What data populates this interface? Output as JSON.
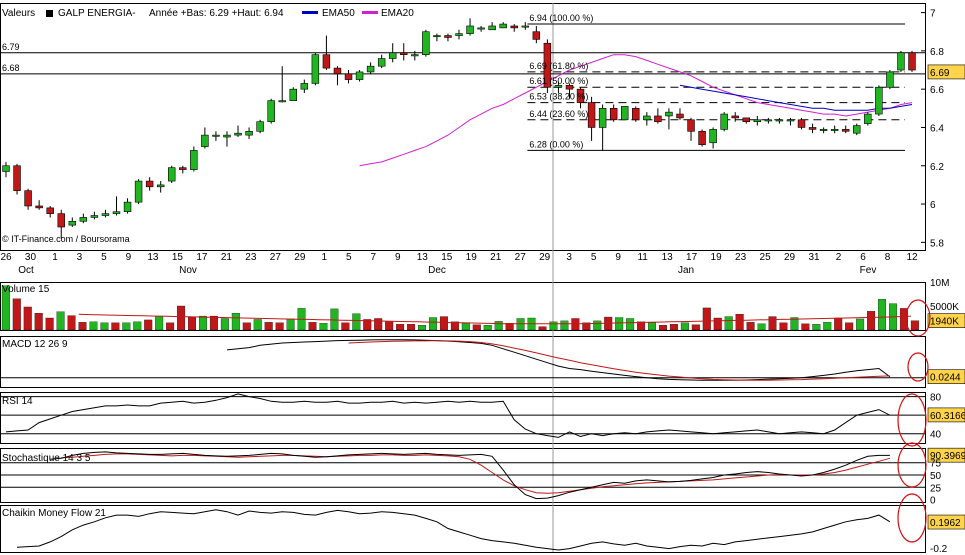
{
  "header": {
    "label": "Valeurs",
    "name": "GALP ENERGIA-",
    "range": "Année +Bas: 6.29 +Haut: 6.94",
    "legend": [
      {
        "name": "EMA50",
        "color": "#0000c0"
      },
      {
        "name": "EMA20",
        "color": "#d020d0"
      }
    ]
  },
  "colors": {
    "up": "#22b522",
    "down": "#c01818",
    "frame": "#000000",
    "grid": "#c8c8c8",
    "badge": "#ffd34a"
  },
  "credit": "© IT-Finance.com / Boursorama",
  "x_axis": {
    "days": [
      "26",
      "30",
      "1",
      "3",
      "5",
      "9",
      "13",
      "15",
      "17",
      "21",
      "23",
      "27",
      "29",
      "1",
      "5",
      "7",
      "9",
      "13",
      "15",
      "19",
      "21",
      "27",
      "29",
      "3",
      "5",
      "9",
      "11",
      "13",
      "17",
      "19",
      "23",
      "25",
      "29",
      "31",
      "2",
      "6",
      "8",
      "12"
    ],
    "months": [
      "Oct",
      "Nov",
      "Dec",
      "Jan",
      "Fev"
    ]
  },
  "chart_data": [
    {
      "type": "candlestick",
      "title": "",
      "y_ticks": [
        "7",
        "6.8",
        "6.6",
        "6.4",
        "6.2",
        "6",
        "5.8"
      ],
      "ylim": [
        5.76,
        7.05
      ],
      "last_value": "6.69",
      "h_lines": [
        {
          "label": "6.79",
          "value": 6.79
        },
        {
          "label": "6.68",
          "value": 6.68
        }
      ],
      "fibonacci": [
        {
          "label": "6.94 (100.00 %)",
          "value": 6.94
        },
        {
          "label": "6.69 (61.80 %)",
          "value": 6.69
        },
        {
          "label": "6.61 (50.00 %)",
          "value": 6.61
        },
        {
          "label": "6.53 (38.20 %)",
          "value": 6.53
        },
        {
          "label": "6.44 (23.60 %)",
          "value": 6.44
        },
        {
          "label": "6.28 (0.00 %)",
          "value": 6.28
        }
      ],
      "candles": [
        [
          6.17,
          6.2,
          6.22,
          6.14
        ],
        [
          6.2,
          6.07,
          6.21,
          6.05
        ],
        [
          6.07,
          5.99,
          6.08,
          5.97
        ],
        [
          5.99,
          5.98,
          6.02,
          5.97
        ],
        [
          5.98,
          5.95,
          5.99,
          5.93
        ],
        [
          5.95,
          5.88,
          5.97,
          5.82
        ],
        [
          5.89,
          5.91,
          5.93,
          5.88
        ],
        [
          5.91,
          5.93,
          5.95,
          5.9
        ],
        [
          5.93,
          5.94,
          5.96,
          5.92
        ],
        [
          5.94,
          5.95,
          5.97,
          5.93
        ],
        [
          5.95,
          5.96,
          6.04,
          5.94
        ],
        [
          5.96,
          6.01,
          6.03,
          5.95
        ],
        [
          6.01,
          6.12,
          6.13,
          6.0
        ],
        [
          6.12,
          6.09,
          6.14,
          6.07
        ],
        [
          6.09,
          6.1,
          6.12,
          6.06
        ],
        [
          6.12,
          6.19,
          6.2,
          6.11
        ],
        [
          6.19,
          6.18,
          6.2,
          6.16
        ],
        [
          6.18,
          6.28,
          6.3,
          6.17
        ],
        [
          6.3,
          6.36,
          6.4,
          6.29
        ],
        [
          6.36,
          6.36,
          6.38,
          6.33
        ],
        [
          6.35,
          6.36,
          6.38,
          6.3
        ],
        [
          6.36,
          6.37,
          6.41,
          6.35
        ],
        [
          6.36,
          6.38,
          6.4,
          6.34
        ],
        [
          6.38,
          6.43,
          6.44,
          6.37
        ],
        [
          6.43,
          6.54,
          6.55,
          6.42
        ],
        [
          6.54,
          6.54,
          6.72,
          6.53
        ],
        [
          6.54,
          6.6,
          6.61,
          6.55
        ],
        [
          6.6,
          6.63,
          6.65,
          6.58
        ],
        [
          6.63,
          6.78,
          6.79,
          6.62
        ],
        [
          6.78,
          6.71,
          6.88,
          6.7
        ],
        [
          6.71,
          6.68,
          6.72,
          6.62
        ],
        [
          6.68,
          6.65,
          6.7,
          6.63
        ],
        [
          6.65,
          6.69,
          6.7,
          6.64
        ],
        [
          6.69,
          6.72,
          6.74,
          6.68
        ],
        [
          6.72,
          6.76,
          6.78,
          6.71
        ],
        [
          6.76,
          6.79,
          6.84,
          6.74
        ],
        [
          6.79,
          6.78,
          6.84,
          6.75
        ],
        [
          6.78,
          6.78,
          6.8,
          6.75
        ],
        [
          6.78,
          6.9,
          6.91,
          6.77
        ],
        [
          6.88,
          6.88,
          6.89,
          6.85
        ],
        [
          6.88,
          6.87,
          6.89,
          6.85
        ],
        [
          6.88,
          6.89,
          6.91,
          6.86
        ],
        [
          6.89,
          6.93,
          6.97,
          6.88
        ],
        [
          6.92,
          6.92,
          6.93,
          6.9
        ],
        [
          6.91,
          6.93,
          6.95,
          6.91
        ],
        [
          6.92,
          6.94,
          6.95,
          6.92
        ],
        [
          6.93,
          6.92,
          6.94,
          6.9
        ],
        [
          6.93,
          6.93,
          6.95,
          6.91
        ],
        [
          6.9,
          6.86,
          6.93,
          6.84
        ],
        [
          6.84,
          6.61,
          6.86,
          6.58
        ],
        [
          6.61,
          6.62,
          6.64,
          6.58
        ],
        [
          6.62,
          6.6,
          6.63,
          6.55
        ],
        [
          6.6,
          6.53,
          6.61,
          6.5
        ],
        [
          6.53,
          6.4,
          6.56,
          6.33
        ],
        [
          6.4,
          6.5,
          6.52,
          6.28
        ],
        [
          6.5,
          6.44,
          6.52,
          6.43
        ],
        [
          6.44,
          6.51,
          6.51,
          6.45
        ],
        [
          6.5,
          6.44,
          6.51,
          6.43
        ],
        [
          6.44,
          6.46,
          6.48,
          6.41
        ],
        [
          6.46,
          6.43,
          6.5,
          6.42
        ],
        [
          6.46,
          6.48,
          6.5,
          6.39
        ],
        [
          6.47,
          6.45,
          6.5,
          6.44
        ],
        [
          6.44,
          6.38,
          6.45,
          6.33
        ],
        [
          6.38,
          6.31,
          6.39,
          6.3
        ],
        [
          6.32,
          6.39,
          6.4,
          6.29
        ],
        [
          6.39,
          6.47,
          6.48,
          6.38
        ],
        [
          6.46,
          6.45,
          6.48,
          6.43
        ],
        [
          6.45,
          6.43,
          6.45,
          6.42
        ],
        [
          6.43,
          6.44,
          6.46,
          6.41
        ],
        [
          6.44,
          6.44,
          6.45,
          6.42
        ],
        [
          6.44,
          6.44,
          6.45,
          6.42
        ],
        [
          6.44,
          6.44,
          6.45,
          6.41
        ],
        [
          6.44,
          6.4,
          6.45,
          6.39
        ],
        [
          6.4,
          6.39,
          6.42,
          6.37
        ],
        [
          6.39,
          6.39,
          6.4,
          6.37
        ],
        [
          6.39,
          6.39,
          6.41,
          6.37
        ],
        [
          6.39,
          6.38,
          6.41,
          6.37
        ],
        [
          6.37,
          6.41,
          6.42,
          6.36
        ],
        [
          6.42,
          6.47,
          6.48,
          6.41
        ],
        [
          6.47,
          6.61,
          6.62,
          6.46
        ],
        [
          6.61,
          6.69,
          6.7,
          6.6
        ],
        [
          6.7,
          6.79,
          6.8,
          6.69
        ],
        [
          6.79,
          6.7,
          6.8,
          6.69
        ]
      ],
      "ema20": [
        6.2,
        6.21,
        6.22,
        6.24,
        6.26,
        6.28,
        6.3,
        6.33,
        6.36,
        6.4,
        6.44,
        6.47,
        6.5,
        6.52,
        6.55,
        6.58,
        6.61,
        6.64,
        6.67,
        6.7,
        6.72,
        6.74,
        6.76,
        6.78,
        6.78,
        6.77,
        6.75,
        6.73,
        6.71,
        6.69,
        6.67,
        6.64,
        6.61,
        6.59,
        6.57,
        6.55,
        6.53,
        6.52,
        6.51,
        6.5,
        6.49,
        6.48,
        6.47,
        6.47,
        6.46,
        6.47,
        6.48,
        6.49,
        6.5,
        6.52,
        6.53
      ],
      "ema50": [
        6.62,
        6.61,
        6.6,
        6.59,
        6.58,
        6.57,
        6.56,
        6.55,
        6.54,
        6.53,
        6.52,
        6.51,
        6.5,
        6.5,
        6.49,
        6.49,
        6.49,
        6.49,
        6.5,
        6.5,
        6.51,
        6.52
      ]
    },
    {
      "type": "bar",
      "title": "Volume 15",
      "y_ticks": [
        "10M",
        "5000K",
        "0"
      ],
      "ylim": [
        0,
        10000
      ],
      "last_value": "1940K",
      "values": [
        9200,
        6500,
        4800,
        3500,
        2500,
        3800,
        3000,
        1600,
        1700,
        1500,
        1500,
        1500,
        1700,
        2100,
        2900,
        1500,
        5000,
        2700,
        2900,
        2900,
        2400,
        3500,
        1500,
        2200,
        1600,
        1500,
        2300,
        4500,
        1600,
        1400,
        4400,
        1500,
        3400,
        2200,
        2400,
        1700,
        1200,
        1200,
        1000,
        2600,
        2800,
        1700,
        1400,
        1100,
        1000,
        1800,
        1400,
        2400,
        2500,
        700,
        1700,
        1900,
        2400,
        1500,
        1900,
        2700,
        2600,
        2400,
        1700,
        1500,
        1000,
        1200,
        1500,
        1100,
        4600,
        2500,
        2800,
        3300,
        1600,
        1300,
        2800,
        1500,
        2600,
        1300,
        1200,
        1600,
        2500,
        1500,
        2300,
        3900,
        6400,
        5500,
        4500,
        1940
      ],
      "ma": [
        3300,
        3200,
        3150,
        3100,
        3050,
        3000,
        2950,
        2900,
        2850,
        2800,
        2750,
        2700,
        2650,
        2600,
        2550,
        2500,
        2450,
        2400,
        2350,
        2300,
        2250,
        2200,
        2150,
        2100,
        2050,
        2000,
        1950,
        1900,
        1850,
        1800,
        1750,
        1700,
        1650,
        1600,
        1550,
        1500,
        1450,
        1400,
        1350,
        1300,
        1300,
        1300,
        1300,
        1300,
        1300,
        1300,
        1300,
        1350,
        1400,
        1450,
        1500,
        1550,
        1600,
        1650,
        1700,
        1750,
        1800,
        1850,
        1900,
        1950,
        2000,
        2050,
        2100,
        2150,
        2200,
        2250,
        2300,
        2350,
        2400,
        2450,
        2500,
        2550,
        2600,
        2650,
        2700,
        2800,
        2900
      ]
    },
    {
      "type": "line",
      "title": "MACD 12 26 9",
      "y_ticks": [],
      "ylim": [
        -0.02,
        0.2
      ],
      "zero_line": 0.02,
      "last_value": "0.0244",
      "macd": [
        0.14,
        0.145,
        0.15,
        0.16,
        0.165,
        0.17,
        0.172,
        0.174,
        0.176,
        0.178,
        0.18,
        0.181,
        0.182,
        0.183,
        0.184,
        0.184,
        0.184,
        0.183,
        0.182,
        0.18,
        0.178,
        0.175,
        0.172,
        0.168,
        0.16,
        0.145,
        0.13,
        0.115,
        0.1,
        0.085,
        0.07,
        0.06,
        0.055,
        0.048,
        0.042,
        0.036,
        0.03,
        0.025,
        0.02,
        0.016,
        0.013,
        0.011,
        0.01,
        0.009,
        0.009,
        0.009,
        0.009,
        0.01,
        0.012,
        0.014,
        0.016,
        0.018,
        0.02,
        0.025,
        0.03,
        0.036,
        0.044,
        0.05,
        0.055,
        0.06,
        0.024
      ],
      "signal": [
        0.17,
        0.172,
        0.174,
        0.176,
        0.177,
        0.178,
        0.179,
        0.179,
        0.18,
        0.179,
        0.178,
        0.176,
        0.172,
        0.166,
        0.158,
        0.148,
        0.138,
        0.127,
        0.116,
        0.105,
        0.095,
        0.085,
        0.076,
        0.067,
        0.059,
        0.051,
        0.044,
        0.038,
        0.032,
        0.027,
        0.023,
        0.019,
        0.016,
        0.013,
        0.011,
        0.01,
        0.009,
        0.009,
        0.009,
        0.01,
        0.011,
        0.012,
        0.014,
        0.016,
        0.018,
        0.02,
        0.022,
        0.024,
        0.026,
        0.028
      ]
    },
    {
      "type": "line",
      "title": "RSI 14",
      "y_ticks": [
        "80",
        "60",
        "40"
      ],
      "ylim": [
        30,
        85
      ],
      "last_value": "60.3166",
      "values": [
        42,
        43,
        44,
        52,
        56,
        60,
        64,
        66,
        68,
        70,
        70,
        71,
        70,
        70,
        73,
        74,
        75,
        73,
        74,
        76,
        79,
        83,
        80,
        78,
        75,
        74,
        74,
        75,
        74,
        74,
        75,
        73,
        73,
        74,
        74,
        75,
        73,
        74,
        73,
        74,
        75,
        74,
        75,
        74,
        74,
        75,
        55,
        45,
        40,
        38,
        36,
        42,
        37,
        40,
        38,
        40,
        41,
        40,
        42,
        43,
        44,
        43,
        42,
        41,
        40,
        41,
        42,
        43,
        44,
        42,
        40,
        41,
        42,
        41,
        40,
        44,
        52,
        60,
        63,
        66,
        60
      ]
    },
    {
      "type": "line",
      "title": "Stochastique 14 3 5",
      "y_ticks": [
        "100",
        "75",
        "50",
        "25",
        "0"
      ],
      "ylim": [
        -5,
        105
      ],
      "last_value": "90.3969",
      "k": [
        82,
        84,
        90,
        94,
        96,
        97,
        95,
        94,
        93,
        92,
        92,
        93,
        94,
        92,
        90,
        89,
        88,
        89,
        90,
        92,
        94,
        93,
        90,
        88,
        86,
        87,
        89,
        91,
        92,
        93,
        94,
        93,
        92,
        93,
        94,
        92,
        91,
        90,
        91,
        92,
        88,
        60,
        30,
        10,
        2,
        3,
        8,
        15,
        20,
        25,
        30,
        35,
        33,
        38,
        40,
        38,
        36,
        37,
        39,
        42,
        45,
        50,
        52,
        55,
        57,
        55,
        52,
        50,
        48,
        50,
        55,
        62,
        70,
        80,
        88,
        90,
        90
      ],
      "d": [
        85,
        86,
        88,
        90,
        92,
        93,
        93,
        92,
        91,
        90,
        89,
        90,
        90,
        89,
        88,
        87,
        86,
        87,
        88,
        89,
        90,
        90,
        89,
        88,
        87,
        88,
        89,
        90,
        90,
        91,
        91,
        90,
        90,
        91,
        90,
        89,
        87,
        82,
        70,
        55,
        40,
        28,
        20,
        14,
        13,
        14,
        17,
        20,
        23,
        26,
        28,
        30,
        32,
        34,
        35,
        36,
        37,
        38,
        39,
        40,
        42,
        44,
        46,
        48,
        50,
        51,
        50,
        50,
        50,
        52,
        55,
        60,
        66,
        72,
        78,
        84
      ]
    },
    {
      "type": "line",
      "title": "Chaikin Money Flow 21",
      "y_ticks": [
        "-0.2"
      ],
      "ylim": [
        -0.25,
        0.45
      ],
      "last_value": "0.1962",
      "values": [
        -0.18,
        -0.17,
        -0.16,
        -0.1,
        -0.02,
        0.08,
        0.15,
        0.2,
        0.26,
        0.3,
        0.3,
        0.28,
        0.32,
        0.35,
        0.34,
        0.33,
        0.32,
        0.35,
        0.38,
        0.35,
        0.3,
        0.36,
        0.34,
        0.33,
        0.35,
        0.34,
        0.31,
        0.3,
        0.34,
        0.37,
        0.35,
        0.32,
        0.33,
        0.35,
        0.34,
        0.32,
        0.3,
        0.25,
        0.2,
        0.1,
        0.05,
        0,
        -0.05,
        -0.08,
        -0.1,
        -0.12,
        -0.15,
        -0.18,
        -0.2,
        -0.22,
        -0.2,
        -0.16,
        -0.12,
        -0.1,
        -0.13,
        -0.15,
        -0.12,
        -0.16,
        -0.18,
        -0.2,
        -0.17,
        -0.15,
        -0.16,
        -0.12,
        -0.14,
        -0.1,
        -0.08,
        -0.06,
        -0.04,
        -0.02,
        0,
        0.02,
        0.05,
        0.1,
        0.15,
        0.2,
        0.23,
        0.25,
        0.3,
        0.2
      ]
    }
  ]
}
